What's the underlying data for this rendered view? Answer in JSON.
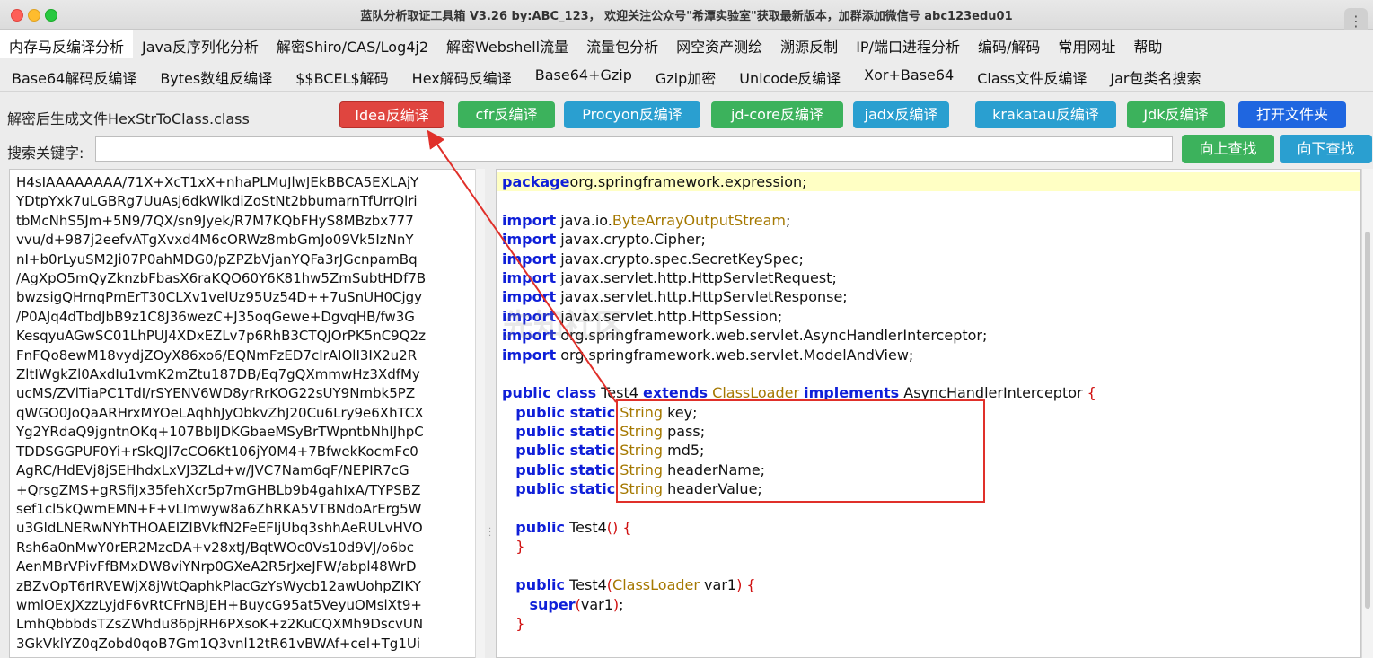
{
  "window": {
    "title": "蓝队分析取证工具箱 V3.26 by:ABC_123， 欢迎关注公众号\"希潭实验室\"获取最新版本，加群添加微信号 abc123edu01",
    "more_icon": "⋮"
  },
  "menu": [
    {
      "label": "内存马反编译分析"
    },
    {
      "label": "Java反序列化分析"
    },
    {
      "label": "解密Shiro/CAS/Log4j2"
    },
    {
      "label": "解密Webshell流量"
    },
    {
      "label": "流量包分析"
    },
    {
      "label": "网空资产测绘"
    },
    {
      "label": "溯源反制"
    },
    {
      "label": "IP/端口进程分析"
    },
    {
      "label": "编码/解码"
    },
    {
      "label": "常用网址"
    },
    {
      "label": "帮助"
    }
  ],
  "tabs": [
    {
      "label": "Base64解码反编译"
    },
    {
      "label": "Bytes数组反编译"
    },
    {
      "label": "$$BCEL$解码"
    },
    {
      "label": "Hex解码反编译"
    },
    {
      "label": "Base64+Gzip"
    },
    {
      "label": "Gzip加密"
    },
    {
      "label": "Unicode反编译"
    },
    {
      "label": "Xor+Base64"
    },
    {
      "label": "Class文件反编译"
    },
    {
      "label": "Jar包类名搜索"
    }
  ],
  "toolbar": {
    "file_label": "解密后生成文件HexStrToClass.class",
    "buttons": [
      {
        "label": "Idea反编译",
        "color": "#e0453f"
      },
      {
        "label": "cfr反编译",
        "color": "#3cb25c"
      },
      {
        "label": "Procyon反编译",
        "color": "#2a9fd0"
      },
      {
        "label": "jd-core反编译",
        "color": "#3cb25c"
      },
      {
        "label": "jadx反编译",
        "color": "#2a9fd0"
      },
      {
        "label": "krakatau反编译",
        "color": "#2a9fd0"
      },
      {
        "label": "Jdk反编译",
        "color": "#3cb25c"
      },
      {
        "label": "打开文件夹",
        "color": "#1f66e0"
      }
    ]
  },
  "search": {
    "label": "搜索关键字:",
    "value": "",
    "up_label": "向上查找",
    "down_label": "向下查找"
  },
  "left_text": [
    "H4sIAAAAAAAA/71X+XcT1xX+nhaPLMuJlwJEkBBCA5EXLAjY",
    "YDtpYxk7uLGBRg7UuAsj6dkWlkdiZoStNt2bbumarnTfUrrQlri",
    "tbMcNhS5Jm+5N9/7QX/sn9Jyek/R7M7KQbFHyS8MBzbx777",
    "vvu/d+987j2eefvATgXvxd4M6cORWz8mbGmJo09Vk5IzNnY",
    "nI+b0rLyuSM2Ji07P0ahMDG0/pZPZbVjanYQFa3rJGcnpamBq",
    "/AgXpO5mQyZknzbFbasX6raKQO60Y6K81hw5ZmSubtHDf7B",
    "bwzsigQHrnqPmErT30CLXv1velUz95Uz54D++7uSnUH0Cjgy",
    "/P0AJq4dTbdJbB9z1C8J36wezC+J35oqGewe+DgvqHB/fw3G",
    "KesqyuAGwSC01LhPUJ4XDxEZLv7p6RhB3CTQJOrPK5nC9Q2z",
    "FnFQo8ewM18vydjZOyX86xo6/EQNmFzED7cIrAIOlI3IX2u2R",
    "ZltIWgkZl0AxdIu1vmK2mZtu187DB/Eq7gQXmmwHz3XdfMy",
    "ucMS/ZVlTiaPC1TdI/rSYENV6WD8yrRrKOG22sUY9Nmbk5PZ",
    "qWGO0JoQaARHrxMYOeLAqhhJyObkvZhJ20Cu6Lry9e6XhTCX",
    "Yg2YRdaQ9jgntnOKq+107BbIJDKGbaeMSyBrTWpntbNhIJhpC",
    "TDDSGGPUF0Yi+rSkQJl7cCO6Kt106jY0M4+7BfwekKocmFc0",
    "AgRC/HdEVj8jSEHhdxLxVJ3ZLd+w/JVC7Nam6qF/NEPIR7cG",
    "+QrsgZMS+gRSfiJx35fehXcr5p7mGHBLb9b4gahIxA/TYPSBZ",
    "sef1cl5kQwmEMN+F+vLImwyw8a6ZhRKA5VTBNdoArErg5W",
    "u3GldLNERwNYhTHOAEIZIBVkfN2FeEFIjUbq3shhAeRULvHVO",
    "Rsh6a0nMwY0rER2MzcDA+v28xtJ/BqtWOc0Vs10d9VJ/o6bc",
    "AenMBrVPivFfBMxDW8viYNrp0GXeA2R5rJxeJFW/abpl48WrD",
    "zBZvOpT6rIRVEWjX8jWtQaphkPlacGzYsWycb12awUohpZIKY",
    "wmlOExJXzzLyjdF6vRtCFrNBJEH+BuycG95at5VeyuOMslXt9+",
    "LmhQbbbdsTZsZWhdu86pjRH6PXsoK+z2KuCQXMh9DscvUN",
    "3GkVklYZ0qZobd0qoB7Gm1Q3vnl12tR61vBWAf+cel+Tg1Ui"
  ],
  "code": {
    "watermark": "先知社区",
    "lines": [
      {
        "cls": "hl",
        "parts": [
          [
            "kw",
            "package"
          ],
          [
            "",
            "org.springframework.expression;"
          ]
        ]
      },
      {
        "cls": "",
        "parts": [
          [
            "",
            ""
          ]
        ]
      },
      {
        "cls": "",
        "parts": [
          [
            "kw",
            "import"
          ],
          [
            "",
            " java.io."
          ],
          [
            "ty",
            "ByteArrayOutputStream"
          ],
          [
            "",
            ";"
          ]
        ]
      },
      {
        "cls": "",
        "parts": [
          [
            "kw",
            "import"
          ],
          [
            "",
            " javax.crypto.Cipher;"
          ]
        ]
      },
      {
        "cls": "",
        "parts": [
          [
            "kw",
            "import"
          ],
          [
            "",
            " javax.crypto.spec.SecretKeySpec;"
          ]
        ]
      },
      {
        "cls": "",
        "parts": [
          [
            "kw",
            "import"
          ],
          [
            "",
            " javax.servlet.http.HttpServletRequest;"
          ]
        ]
      },
      {
        "cls": "",
        "parts": [
          [
            "kw",
            "import"
          ],
          [
            "",
            " javax.servlet.http.HttpServletResponse;"
          ]
        ]
      },
      {
        "cls": "",
        "parts": [
          [
            "kw",
            "import"
          ],
          [
            "",
            " javax.servlet.http.HttpSession;"
          ]
        ]
      },
      {
        "cls": "",
        "parts": [
          [
            "kw",
            "import"
          ],
          [
            "",
            " org.springframework.web.servlet.AsyncHandlerInterceptor;"
          ]
        ]
      },
      {
        "cls": "",
        "parts": [
          [
            "kw",
            "import"
          ],
          [
            "",
            " org.springframework.web.servlet.ModelAndView;"
          ]
        ]
      },
      {
        "cls": "",
        "parts": [
          [
            "",
            ""
          ]
        ]
      },
      {
        "cls": "",
        "parts": [
          [
            "kw",
            "public class"
          ],
          [
            "",
            " Test4 "
          ],
          [
            "kw",
            "extends"
          ],
          [
            "",
            " "
          ],
          [
            "ty",
            "ClassLoader"
          ],
          [
            "",
            " "
          ],
          [
            "kw",
            "implements"
          ],
          [
            "",
            " AsyncHandlerInterceptor "
          ],
          [
            "pn",
            "{"
          ]
        ]
      },
      {
        "cls": "",
        "parts": [
          [
            "",
            "   "
          ],
          [
            "kw",
            "public static"
          ],
          [
            "",
            " "
          ],
          [
            "ty",
            "String"
          ],
          [
            "",
            " key;"
          ]
        ]
      },
      {
        "cls": "",
        "parts": [
          [
            "",
            "   "
          ],
          [
            "kw",
            "public static"
          ],
          [
            "",
            " "
          ],
          [
            "ty",
            "String"
          ],
          [
            "",
            " pass;"
          ]
        ]
      },
      {
        "cls": "",
        "parts": [
          [
            "",
            "   "
          ],
          [
            "kw",
            "public static"
          ],
          [
            "",
            " "
          ],
          [
            "ty",
            "String"
          ],
          [
            "",
            " md5;"
          ]
        ]
      },
      {
        "cls": "",
        "parts": [
          [
            "",
            "   "
          ],
          [
            "kw",
            "public static"
          ],
          [
            "",
            " "
          ],
          [
            "ty",
            "String"
          ],
          [
            "",
            " headerName;"
          ]
        ]
      },
      {
        "cls": "",
        "parts": [
          [
            "",
            "   "
          ],
          [
            "kw",
            "public static"
          ],
          [
            "",
            " "
          ],
          [
            "ty",
            "String"
          ],
          [
            "",
            " headerValue;"
          ]
        ]
      },
      {
        "cls": "",
        "parts": [
          [
            "",
            ""
          ]
        ]
      },
      {
        "cls": "",
        "parts": [
          [
            "",
            "   "
          ],
          [
            "kw",
            "public"
          ],
          [
            "",
            " Test4"
          ],
          [
            "pn",
            "() {"
          ]
        ]
      },
      {
        "cls": "",
        "parts": [
          [
            "",
            "   "
          ],
          [
            "pn",
            "}"
          ]
        ]
      },
      {
        "cls": "",
        "parts": [
          [
            "",
            ""
          ]
        ]
      },
      {
        "cls": "",
        "parts": [
          [
            "",
            "   "
          ],
          [
            "kw",
            "public"
          ],
          [
            "",
            " Test4"
          ],
          [
            "pn",
            "("
          ],
          [
            "ty",
            "ClassLoader"
          ],
          [
            "",
            " var1"
          ],
          [
            "pn",
            ") {"
          ]
        ]
      },
      {
        "cls": "",
        "parts": [
          [
            "",
            "      "
          ],
          [
            "kw",
            "super"
          ],
          [
            "pn",
            "("
          ],
          [
            "",
            "var1"
          ],
          [
            "pn",
            ")"
          ],
          [
            "",
            ";"
          ]
        ]
      },
      {
        "cls": "",
        "parts": [
          [
            "",
            "   "
          ],
          [
            "pn",
            "}"
          ]
        ]
      }
    ]
  }
}
